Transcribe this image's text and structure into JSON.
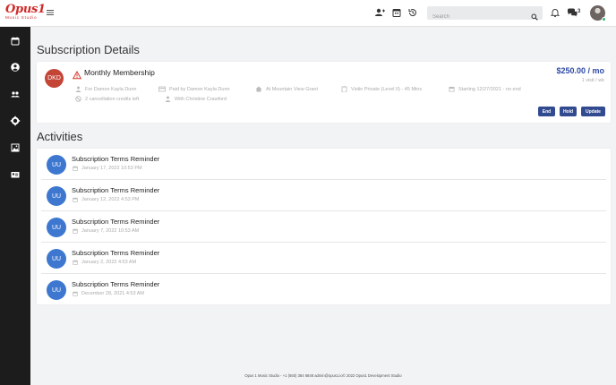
{
  "brand": {
    "logo_text": "Opus1",
    "logo_subtext": "Music Studio",
    "color": "#d12a2a"
  },
  "header": {
    "search_placeholder": "Search",
    "message_count": "3",
    "icons": [
      "add-user-icon",
      "calendar-icon",
      "history-icon",
      "search-icon",
      "bell-icon",
      "chat-icon"
    ]
  },
  "sidebar": {
    "items": [
      {
        "icon": "calendar-icon"
      },
      {
        "icon": "user-circle-icon"
      },
      {
        "icon": "users-icon"
      },
      {
        "icon": "gear-icon"
      },
      {
        "icon": "image-icon"
      },
      {
        "icon": "id-card-icon"
      }
    ]
  },
  "subscription": {
    "heading": "Subscription Details",
    "initials": "DKD",
    "plan_name": "Monthly Membership",
    "price": "$250.00 / mo",
    "visit_frequency": "1 visit / wk",
    "for_text": "For Damon Kayla Dunn",
    "paid_by": "Paid by Damon Kayla Dunn",
    "location": "At Mountain View Grant",
    "lesson": "Violin Private (Level II) - 45 Mins",
    "starting": "Starting 12/27/2021 - no end",
    "credits": "2 cancellation credits left",
    "teacher": "With Christine Crawford",
    "buttons": {
      "end": "End",
      "hold": "Hold",
      "update": "Update"
    },
    "colors": {
      "avatar": "#c44536",
      "price": "#2f4aa5",
      "button": "#324a8f",
      "warning": "#d9362b"
    }
  },
  "activities": {
    "heading": "Activities",
    "items": [
      {
        "initials": "UU",
        "title": "Subscription Terms Reminder",
        "date": "January 17, 2022 10:53 PM"
      },
      {
        "initials": "UU",
        "title": "Subscription Terms Reminder",
        "date": "January 12, 2022 4:53 PM"
      },
      {
        "initials": "UU",
        "title": "Subscription Terms Reminder",
        "date": "January 7, 2022 10:53 AM"
      },
      {
        "initials": "UU",
        "title": "Subscription Terms Reminder",
        "date": "January 2, 2022 4:53 AM"
      },
      {
        "initials": "UU",
        "title": "Subscription Terms Reminder",
        "date": "December 28, 2021 4:53 AM"
      }
    ],
    "avatar_color": "#3d77cf"
  },
  "footer": {
    "text": "Opus 1 Music Studio - +1 (650) 384 6848 admin@opus1.io© 2022 Opus1 Development Studio"
  }
}
